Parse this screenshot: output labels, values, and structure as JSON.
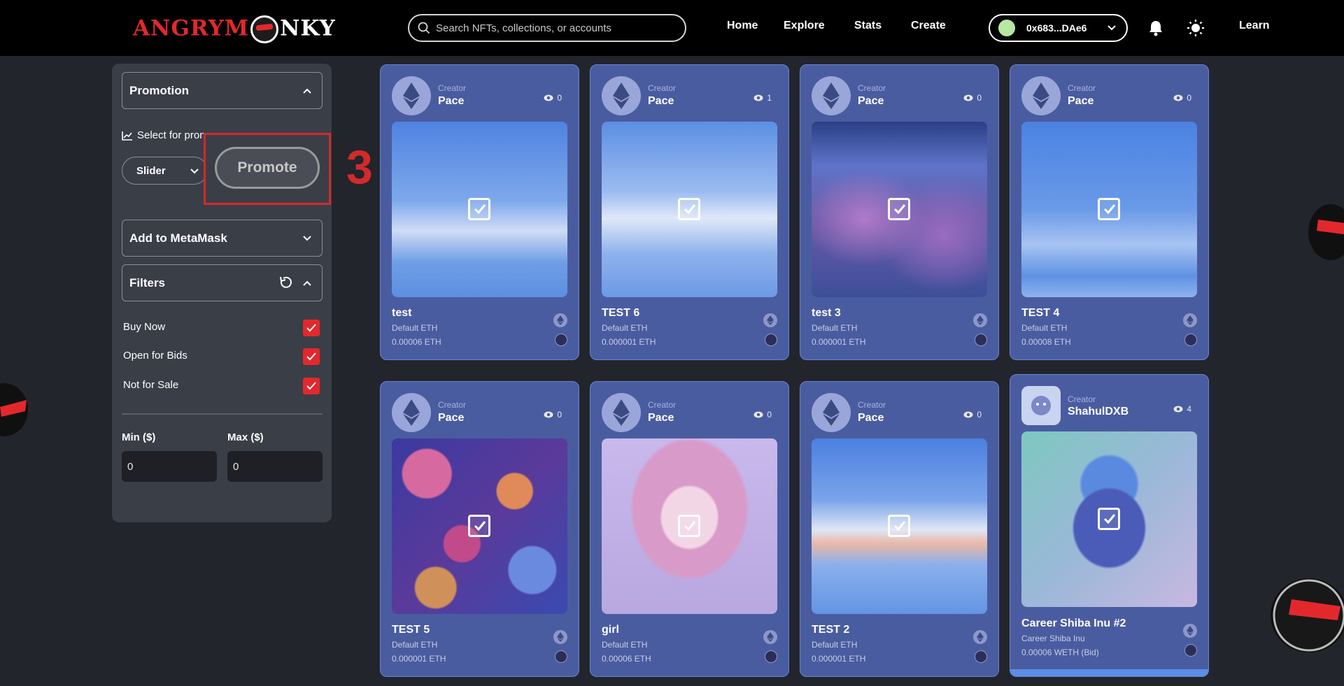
{
  "header": {
    "brand": {
      "part1": "ANGRYM",
      "part2": "NKY"
    },
    "search": {
      "placeholder": "Search NFTs, collections, or accounts"
    },
    "nav": [
      "Home",
      "Explore",
      "Stats",
      "Create"
    ],
    "wallet": {
      "address": "0x683...DAe6",
      "status_color": "#b6e8a0"
    },
    "learn": "Learn"
  },
  "sidebar": {
    "promotion": {
      "title": "Promotion",
      "select_label": "Select for pron",
      "select_value": "Slider",
      "promote_button": "Promote",
      "step_marker": "3"
    },
    "metamask": {
      "title": "Add to MetaMask"
    },
    "filters": {
      "title": "Filters",
      "options": [
        {
          "label": "Buy Now",
          "checked": true
        },
        {
          "label": "Open for Bids",
          "checked": true
        },
        {
          "label": "Not for Sale",
          "checked": true
        }
      ],
      "min_label": "Min ($)",
      "max_label": "Max ($)",
      "min_value": "0",
      "max_value": "0"
    }
  },
  "cards": [
    {
      "creator_label": "Creator",
      "creator": "Pace",
      "views": "0",
      "title": "test",
      "collection": "Default ETH",
      "price": "0.00006  ETH"
    },
    {
      "creator_label": "Creator",
      "creator": "Pace",
      "views": "1",
      "title": "TEST 6",
      "collection": "Default ETH",
      "price": "0.000001  ETH"
    },
    {
      "creator_label": "Creator",
      "creator": "Pace",
      "views": "0",
      "title": "test 3",
      "collection": "Default ETH",
      "price": "0.000001  ETH"
    },
    {
      "creator_label": "Creator",
      "creator": "Pace",
      "views": "0",
      "title": "TEST 4",
      "collection": "Default ETH",
      "price": "0.00008  ETH"
    },
    {
      "creator_label": "Creator",
      "creator": "Pace",
      "views": "0",
      "title": "TEST 5",
      "collection": "Default ETH",
      "price": "0.000001  ETH"
    },
    {
      "creator_label": "Creator",
      "creator": "Pace",
      "views": "0",
      "title": "girl",
      "collection": "Default ETH",
      "price": "0.00006  ETH"
    },
    {
      "creator_label": "Creator",
      "creator": "Pace",
      "views": "0",
      "title": "TEST 2",
      "collection": "Default ETH",
      "price": "0.000001  ETH"
    },
    {
      "creator_label": "Creator",
      "creator": "ShahulDXB",
      "views": "4",
      "title": "Career Shiba Inu #2",
      "collection": "Career Shiba Inu",
      "price": "0.00006  WETH (Bid)"
    }
  ],
  "colors": {
    "accent_red": "#e3282d",
    "card_bg": "#4a5ca0",
    "page_bg": "#22252b"
  }
}
